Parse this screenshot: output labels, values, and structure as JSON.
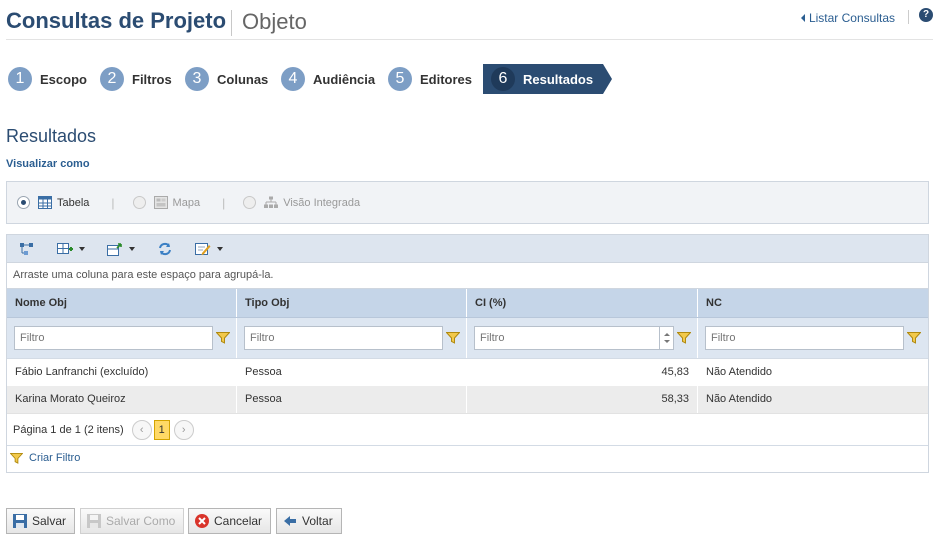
{
  "header": {
    "title": "Consultas de Projeto",
    "subtitle": "Objeto",
    "list_link": "Listar Consultas",
    "help_label": "?"
  },
  "steps": [
    {
      "num": "1",
      "label": "Escopo"
    },
    {
      "num": "2",
      "label": "Filtros"
    },
    {
      "num": "3",
      "label": "Colunas"
    },
    {
      "num": "4",
      "label": "Audiência"
    },
    {
      "num": "5",
      "label": "Editores"
    },
    {
      "num": "6",
      "label": "Resultados",
      "active": true
    }
  ],
  "section_title": "Resultados",
  "view_as_label": "Visualizar como",
  "view_options": {
    "table": "Tabela",
    "map": "Mapa",
    "integrated": "Visão Integrada",
    "selected": "table"
  },
  "grid": {
    "group_hint": "Arraste uma coluna para este espaço para agrupá-la.",
    "columns": [
      "Nome Obj",
      "Tipo Obj",
      "CI (%)",
      "NC"
    ],
    "filter_placeholder": "Filtro",
    "rows": [
      [
        "Fábio Lanfranchi (excluído)",
        "Pessoa",
        "45,83",
        "Não Atendido"
      ],
      [
        "Karina Morato Queiroz",
        "Pessoa",
        "58,33",
        "Não Atendido"
      ]
    ],
    "pager_text": "Página 1 de 1 (2 itens)",
    "current_page": "1",
    "prev_symbol": "‹",
    "next_symbol": "›",
    "create_filter": "Criar Filtro"
  },
  "buttons": {
    "save": "Salvar",
    "save_as": "Salvar Como",
    "cancel": "Cancelar",
    "back": "Voltar"
  },
  "colors": {
    "brand": "#2b4c72",
    "step_circle": "#7d9ec5",
    "header_row": "#c5d5e8",
    "active_page": "#ffd966"
  }
}
